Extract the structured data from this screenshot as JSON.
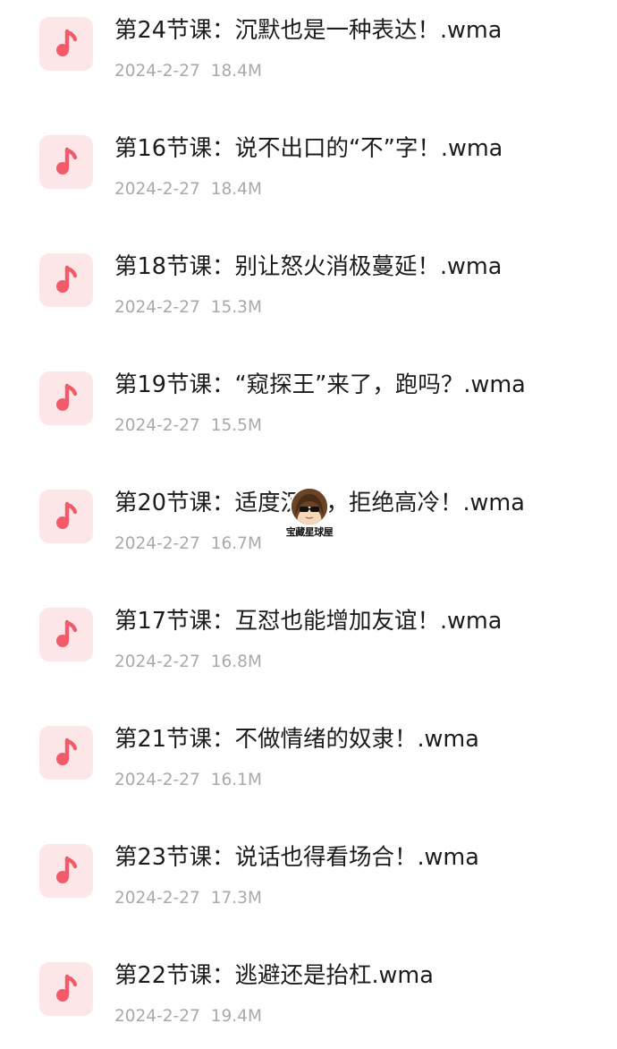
{
  "accent_color": "#f25c6a",
  "icon_background": "#fde6e8",
  "file_icon_name": "music-note-icon",
  "files": [
    {
      "name": "第24节课：沉默也是一种表达！.wma",
      "date": "2024-2-27",
      "size": "18.4M"
    },
    {
      "name": "第16节课：说不出口的“不”字！.wma",
      "date": "2024-2-27",
      "size": "18.4M"
    },
    {
      "name": "第18节课：别让怒火消极蔓延！.wma",
      "date": "2024-2-27",
      "size": "15.3M"
    },
    {
      "name": "第19节课：“窥探王”来了，跑吗？.wma",
      "date": "2024-2-27",
      "size": "15.5M"
    },
    {
      "name": "第20节课：适度沉默，拒绝高冷！.wma",
      "date": "2024-2-27",
      "size": "16.7M"
    },
    {
      "name": "第17节课：互怼也能增加友谊！.wma",
      "date": "2024-2-27",
      "size": "16.8M"
    },
    {
      "name": "第21节课：不做情绪的奴隶！.wma",
      "date": "2024-2-27",
      "size": "16.1M"
    },
    {
      "name": "第23节课：说话也得看场合！.wma",
      "date": "2024-2-27",
      "size": "17.3M"
    },
    {
      "name": "第22节课：逃避还是抬杠.wma",
      "date": "2024-2-27",
      "size": "19.4M"
    }
  ],
  "watermark": {
    "text": "宝藏星球屋",
    "icon": "cartoon-avatar-icon"
  }
}
